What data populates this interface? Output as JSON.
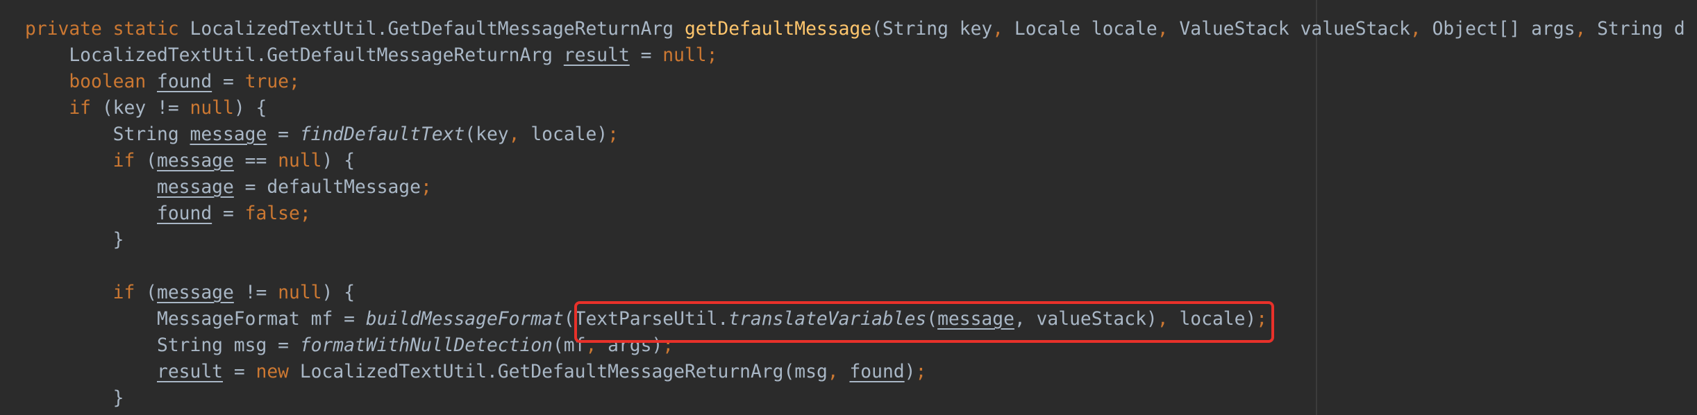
{
  "editor": {
    "highlight_color": "#e8312a",
    "colors": {
      "background": "#2b2b2b",
      "text": "#a9b7c6",
      "keyword": "#cc7832",
      "method_decl": "#ffc66d"
    },
    "lines": [
      {
        "tokens": [
          {
            "t": "private static",
            "c": "kw"
          },
          {
            "t": " LocalizedTextUtil.GetDefaultMessageReturnArg "
          },
          {
            "t": "getDefaultMessage",
            "c": "fn"
          },
          {
            "t": "(String key"
          },
          {
            "t": ",",
            "c": "punc"
          },
          {
            "t": " Locale locale"
          },
          {
            "t": ",",
            "c": "punc"
          },
          {
            "t": " ValueStack valueStack"
          },
          {
            "t": ",",
            "c": "punc"
          },
          {
            "t": " Object[] args"
          },
          {
            "t": ",",
            "c": "punc"
          },
          {
            "t": " String d"
          }
        ]
      },
      {
        "tokens": [
          {
            "t": "    LocalizedTextUtil.GetDefaultMessageReturnArg "
          },
          {
            "t": "result",
            "c": "u"
          },
          {
            "t": " = "
          },
          {
            "t": "null",
            "c": "kw"
          },
          {
            "t": ";",
            "c": "punc"
          }
        ]
      },
      {
        "tokens": [
          {
            "t": "    "
          },
          {
            "t": "boolean",
            "c": "kw"
          },
          {
            "t": " "
          },
          {
            "t": "found",
            "c": "u"
          },
          {
            "t": " = "
          },
          {
            "t": "true",
            "c": "kw"
          },
          {
            "t": ";",
            "c": "punc"
          }
        ]
      },
      {
        "tokens": [
          {
            "t": "    "
          },
          {
            "t": "if",
            "c": "kw"
          },
          {
            "t": " (key != "
          },
          {
            "t": "null",
            "c": "kw"
          },
          {
            "t": ") {"
          }
        ]
      },
      {
        "tokens": [
          {
            "t": "        String "
          },
          {
            "t": "message",
            "c": "u"
          },
          {
            "t": " = "
          },
          {
            "t": "findDefaultText",
            "c": "it"
          },
          {
            "t": "(key"
          },
          {
            "t": ",",
            "c": "punc"
          },
          {
            "t": " locale)"
          },
          {
            "t": ";",
            "c": "punc"
          }
        ]
      },
      {
        "tokens": [
          {
            "t": "        "
          },
          {
            "t": "if",
            "c": "kw"
          },
          {
            "t": " ("
          },
          {
            "t": "message",
            "c": "u"
          },
          {
            "t": " == "
          },
          {
            "t": "null",
            "c": "kw"
          },
          {
            "t": ") {"
          }
        ]
      },
      {
        "tokens": [
          {
            "t": "            "
          },
          {
            "t": "message",
            "c": "u"
          },
          {
            "t": " = defaultMessage"
          },
          {
            "t": ";",
            "c": "punc"
          }
        ]
      },
      {
        "tokens": [
          {
            "t": "            "
          },
          {
            "t": "found",
            "c": "u"
          },
          {
            "t": " = "
          },
          {
            "t": "false",
            "c": "kw"
          },
          {
            "t": ";",
            "c": "punc"
          }
        ]
      },
      {
        "tokens": [
          {
            "t": "        }"
          }
        ]
      },
      {
        "tokens": [
          {
            "t": ""
          }
        ]
      },
      {
        "tokens": [
          {
            "t": "        "
          },
          {
            "t": "if",
            "c": "kw"
          },
          {
            "t": " ("
          },
          {
            "t": "message",
            "c": "u"
          },
          {
            "t": " != "
          },
          {
            "t": "null",
            "c": "kw"
          },
          {
            "t": ") {"
          }
        ]
      },
      {
        "tokens": [
          {
            "t": "            MessageFormat mf = "
          },
          {
            "t": "buildMessageFormat",
            "c": "it"
          },
          {
            "t": "(TextParseUtil."
          },
          {
            "t": "translateVariables",
            "c": "it"
          },
          {
            "t": "("
          },
          {
            "t": "message",
            "c": "u"
          },
          {
            "t": ","
          },
          {
            "t": " valueStack)"
          },
          {
            "t": ",",
            "c": "punc"
          },
          {
            "t": " locale)"
          },
          {
            "t": ";",
            "c": "punc"
          }
        ]
      },
      {
        "tokens": [
          {
            "t": "            String msg = "
          },
          {
            "t": "formatWithNullDetection",
            "c": "it"
          },
          {
            "t": "(mf"
          },
          {
            "t": ",",
            "c": "punc"
          },
          {
            "t": " args)"
          },
          {
            "t": ";",
            "c": "punc"
          }
        ]
      },
      {
        "tokens": [
          {
            "t": "            "
          },
          {
            "t": "result",
            "c": "u"
          },
          {
            "t": " = "
          },
          {
            "t": "new",
            "c": "kw"
          },
          {
            "t": " LocalizedTextUtil.GetDefaultMessageReturnArg(msg"
          },
          {
            "t": ",",
            "c": "punc"
          },
          {
            "t": " "
          },
          {
            "t": "found",
            "c": "u"
          },
          {
            "t": ")"
          },
          {
            "t": ";",
            "c": "punc"
          }
        ]
      },
      {
        "tokens": [
          {
            "t": "        }"
          }
        ]
      }
    ]
  }
}
